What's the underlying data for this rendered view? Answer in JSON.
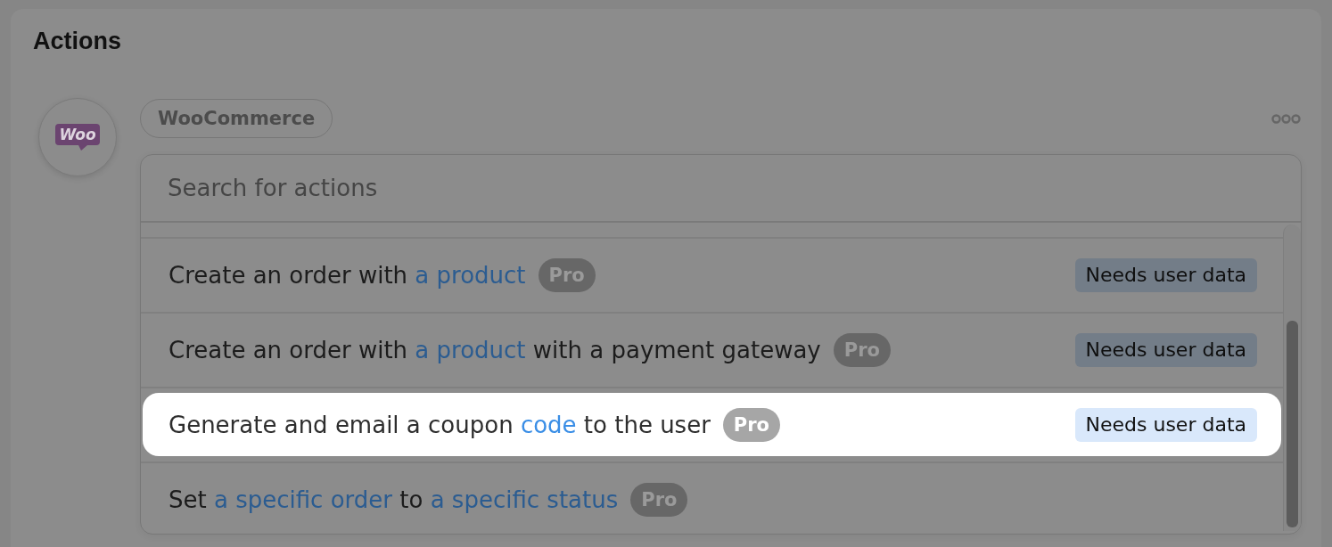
{
  "section": {
    "title": "Actions"
  },
  "integration": {
    "logo_text": "Woo",
    "name": "WooCommerce"
  },
  "search": {
    "placeholder": "Search for actions"
  },
  "actions": [
    {
      "parts": [
        {
          "kind": "plain",
          "text": "Create an order with "
        },
        {
          "kind": "link",
          "text": "a product"
        }
      ],
      "badge": "Pro",
      "tag": "Needs user data",
      "selected": false
    },
    {
      "parts": [
        {
          "kind": "plain",
          "text": "Create an order with "
        },
        {
          "kind": "link",
          "text": "a product"
        },
        {
          "kind": "plain",
          "text": " with a payment gateway"
        }
      ],
      "badge": "Pro",
      "tag": "Needs user data",
      "selected": false
    },
    {
      "parts": [
        {
          "kind": "plain",
          "text": "Generate and email a coupon "
        },
        {
          "kind": "link",
          "text": "code"
        },
        {
          "kind": "plain",
          "text": " to the user"
        }
      ],
      "badge": "Pro",
      "tag": "Needs user data",
      "selected": true
    },
    {
      "parts": [
        {
          "kind": "plain",
          "text": "Set "
        },
        {
          "kind": "link",
          "text": "a specific order"
        },
        {
          "kind": "plain",
          "text": " to "
        },
        {
          "kind": "link",
          "text": "a specific status"
        }
      ],
      "badge": "Pro",
      "selected": false
    }
  ]
}
